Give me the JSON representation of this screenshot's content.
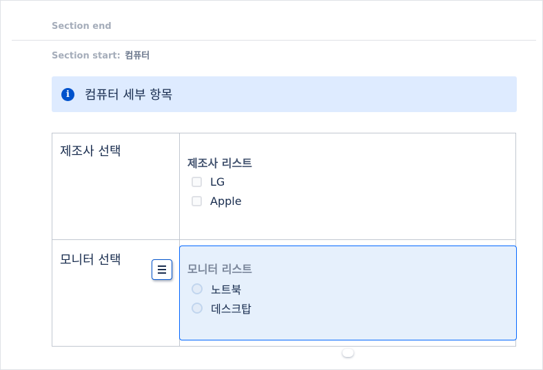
{
  "sections": {
    "end_label": "Section end",
    "start_label": "Section start:",
    "start_name": "컴퓨터"
  },
  "info_panel": {
    "icon": "info-icon",
    "text": "컴퓨터 세부 항목",
    "color": "#deebff"
  },
  "table": {
    "rows": [
      {
        "label": "제조사 선택",
        "group_title": "제조사 리스트",
        "control": "checkbox",
        "options": [
          "LG",
          "Apple"
        ]
      },
      {
        "label": "모니터 선택",
        "group_title": "모니터 리스트",
        "control": "radio",
        "options": [
          "노트북",
          "데스크탑"
        ],
        "selected": true,
        "menu_icon": "hamburger-menu-icon"
      }
    ]
  },
  "colors": {
    "accent": "#0052cc",
    "selected_border": "#0065ff",
    "selected_background": "#e6f0fc"
  }
}
